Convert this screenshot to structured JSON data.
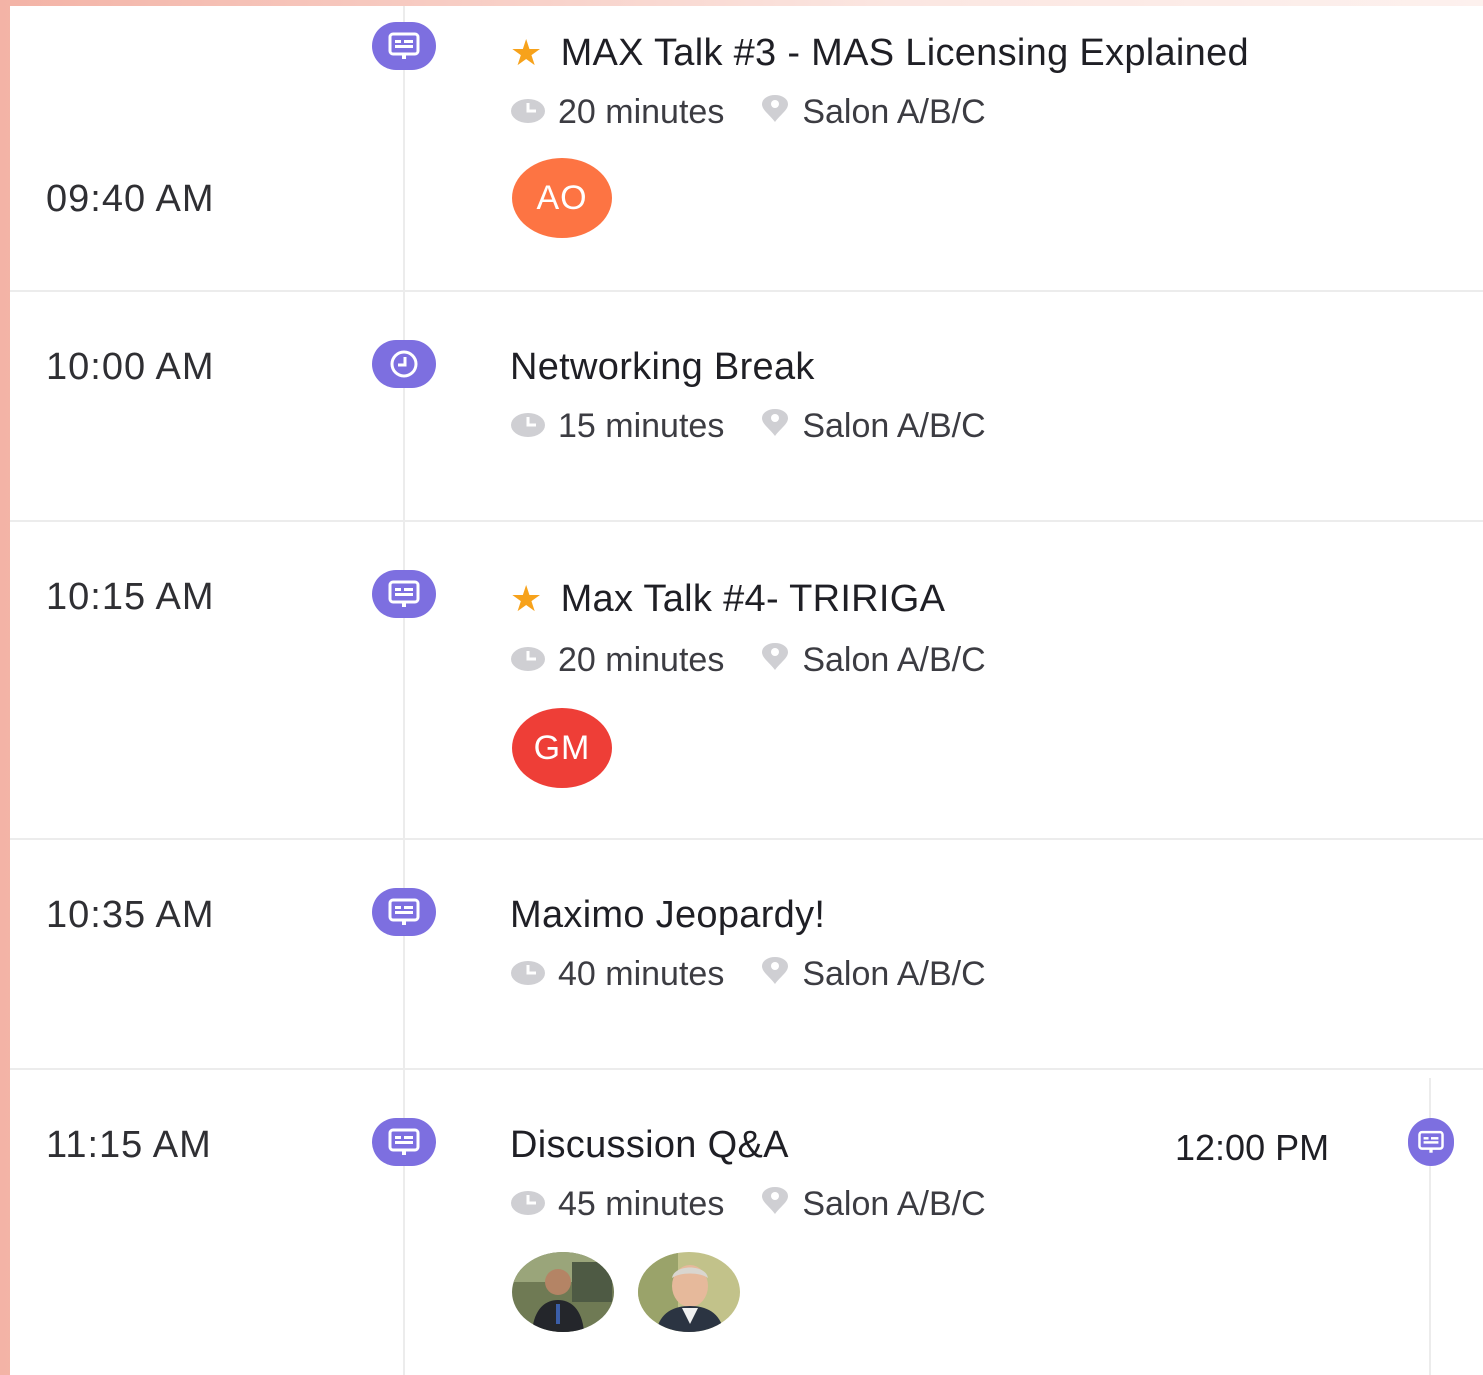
{
  "colors": {
    "accent": "#7d6fe0",
    "star": "#f7a21b",
    "avatar_ao": "#fd7443",
    "avatar_gm": "#ee3e37"
  },
  "sessions": [
    {
      "time": "09:40 AM",
      "type_icon": "presentation-icon",
      "starred": true,
      "title": "MAX Talk #3 - MAS Licensing Explained",
      "duration": "20 minutes",
      "location": "Salon A/B/C",
      "speakers": [
        {
          "initials": "AO"
        }
      ]
    },
    {
      "time": "10:00 AM",
      "type_icon": "break-clock-icon",
      "starred": false,
      "title": "Networking Break",
      "duration": "15 minutes",
      "location": "Salon A/B/C",
      "speakers": []
    },
    {
      "time": "10:15 AM",
      "type_icon": "presentation-icon",
      "starred": true,
      "title": "Max Talk #4- TRIRIGA",
      "duration": "20 minutes",
      "location": "Salon A/B/C",
      "speakers": [
        {
          "initials": "GM"
        }
      ]
    },
    {
      "time": "10:35 AM",
      "type_icon": "presentation-icon",
      "starred": false,
      "title": "Maximo Jeopardy!",
      "duration": "40 minutes",
      "location": "Salon A/B/C",
      "speakers": []
    },
    {
      "time": "11:15 AM",
      "type_icon": "presentation-icon",
      "starred": false,
      "title": "Discussion Q&A",
      "duration": "45 minutes",
      "location": "Salon A/B/C",
      "speakers": [
        {
          "photo": "speaker-photo-1"
        },
        {
          "photo": "speaker-photo-2"
        }
      ]
    }
  ],
  "next_column": {
    "time": "12:00 PM",
    "type_icon": "presentation-icon"
  }
}
